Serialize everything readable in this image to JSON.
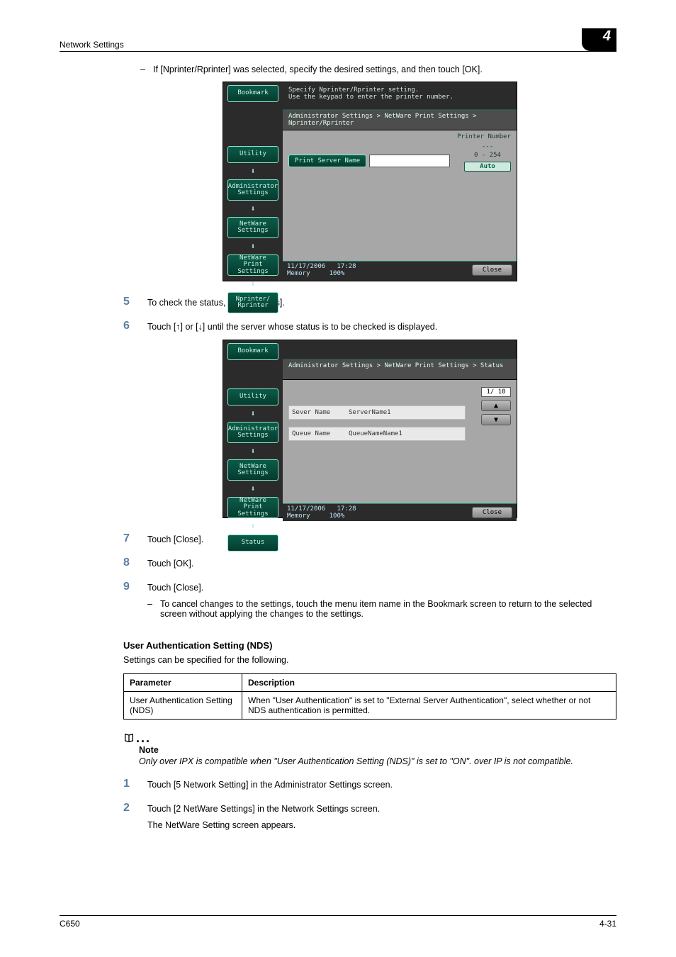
{
  "header": {
    "section": "Network Settings",
    "chapter": "4"
  },
  "footer": {
    "model": "C650",
    "page": "4-31"
  },
  "intro_dash": "If [Nprinter/Rprinter] was selected, specify the desired settings, and then touch [OK].",
  "device1": {
    "msg_line1": "Specify Nprinter/Rprinter setting.",
    "msg_line2": "Use the keypad to enter the printer number.",
    "crumb": "Administrator Settings > NetWare Print Settings > Nprinter/Rprinter",
    "sidebar": {
      "bookmark": "Bookmark",
      "utility": "Utility",
      "admin": "Administrator Settings",
      "netware": "NetWare Settings",
      "nwprint": "NetWare Print Settings",
      "nprinter": "Nprinter/ Rprinter"
    },
    "print_server_label": "Print Server Name",
    "right_label": "Printer Number",
    "right_dashes": "---",
    "right_range": "0  -  254",
    "right_auto": "Auto",
    "footer_date": "11/17/2006",
    "footer_time": "17:28",
    "footer_mem": "Memory",
    "footer_mem_val": "100%",
    "close": "Close"
  },
  "steps_mid": {
    "s5": "To check the status, touch [Status].",
    "s6": "Touch [↑] or [↓] until the server whose status is to be checked is displayed."
  },
  "device2": {
    "crumb": "Administrator Settings > NetWare Print Settings > Status",
    "sidebar": {
      "bookmark": "Bookmark",
      "utility": "Utility",
      "admin": "Administrator Settings",
      "netware": "NetWare Settings",
      "nwprint": "NetWare Print Settings",
      "status": "Status"
    },
    "server_label": "Sever Name",
    "server_val": "ServerName1",
    "queue_label": "Queue Name",
    "queue_val": "QueueNameName1",
    "page_ind": "1/ 10",
    "footer_date": "11/17/2006",
    "footer_time": "17:28",
    "footer_mem": "Memory",
    "footer_mem_val": "100%",
    "close": "Close"
  },
  "steps_after": {
    "s7": "Touch [Close].",
    "s8": "Touch [OK].",
    "s9": "Touch [Close].",
    "s9_dash": "To cancel changes to the settings, touch the menu item name in the Bookmark screen to return to the selected screen without applying the changes to the settings."
  },
  "section": {
    "heading": "User Authentication Setting (NDS)",
    "intro": "Settings can be specified for the following."
  },
  "table": {
    "h1": "Parameter",
    "h2": "Description",
    "r1c1": "User Authentication Setting (NDS)",
    "r1c2": "When \"User Authentication\" is set to \"External Server Authentication\", select whether or not NDS authentication is permitted."
  },
  "note": {
    "label": "Note",
    "body": "Only over IPX is compatible when \"User Authentication Setting (NDS)\" is set to \"ON\". over IP is not compatible."
  },
  "steps_end": {
    "s1": "Touch [5 Network Setting] in the Administrator Settings screen.",
    "s2": "Touch [2 NetWare Settings] in the Network Settings screen.",
    "s2_sub": "The NetWare Setting screen appears."
  }
}
